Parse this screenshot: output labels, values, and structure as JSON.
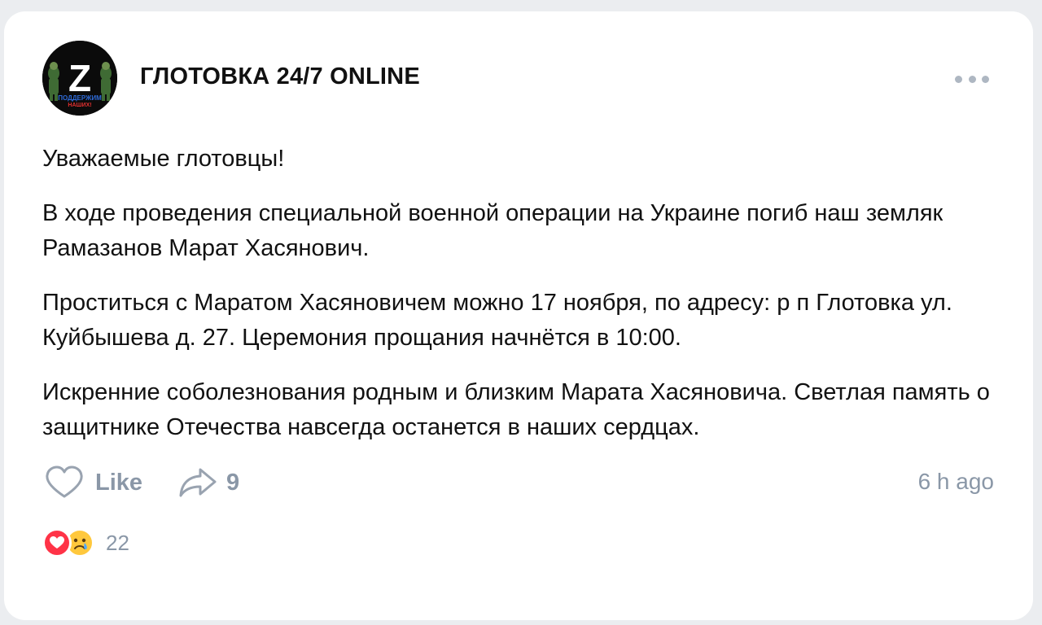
{
  "post": {
    "group_name": "ГЛОТОВКА 24/7 ONLINE",
    "avatar": {
      "icon": "z-logo-icon",
      "letter": "Z",
      "caption_line1": "ПОДДЕРЖИМ",
      "caption_line2": "НАШИХ!"
    },
    "menu_icon": "more-dots-icon",
    "paragraphs": [
      "Уважаемые глотовцы!",
      "В ходе проведения специальной военной операции на Украине погиб наш земляк Рамазанов Марат Хасянович.",
      "Проститься с Маратом Хасяновичем можно 17 ноября, по адресу: р п Глотовка ул. Куйбышева д. 27. Церемония прощания начнётся в 10:00.",
      "Искренние соболезнования родным и близким Марата Хасяновича. Светлая память о защитнике Отечества навсегда останется в наших сердцах."
    ],
    "actions": {
      "like_label": "Like",
      "like_icon": "heart-outline-icon",
      "share_icon": "share-arrow-icon",
      "share_count": "9"
    },
    "time": "6 h ago",
    "reactions": {
      "icons": [
        "heart-reaction-icon",
        "sad-reaction-icon"
      ],
      "count": "22"
    }
  },
  "colors": {
    "background": "#ebedf0",
    "card": "#ffffff",
    "text": "#111111",
    "muted": "#8a97a7",
    "heart": "#ff3347",
    "sad": "#ffc83d"
  }
}
